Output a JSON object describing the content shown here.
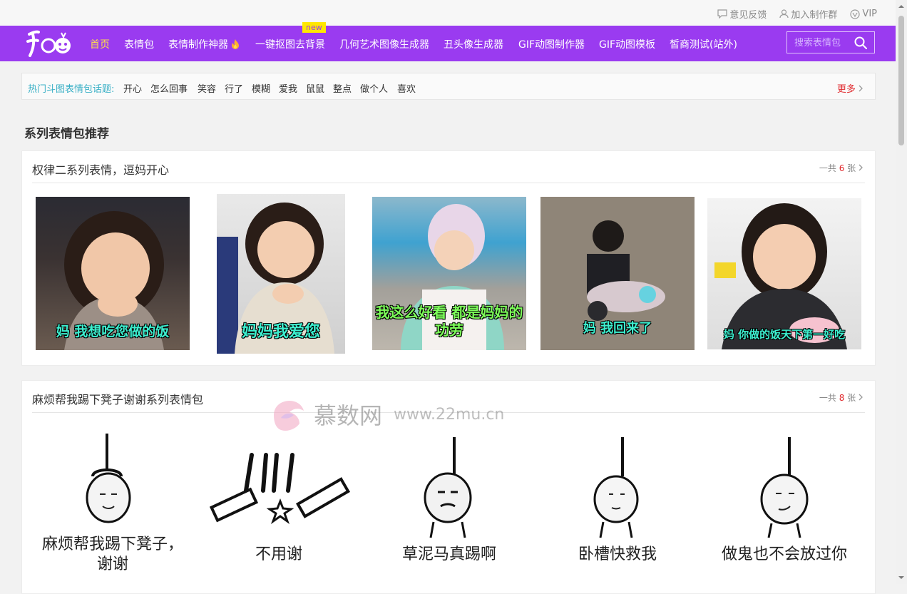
{
  "topbar": {
    "feedback": "意见反馈",
    "join_group": "加入制作群",
    "vip": "VIP"
  },
  "nav": {
    "logo_alt": "斗图啦",
    "items": [
      "首页",
      "表情包",
      "表情制作神器",
      "一键抠图去背景",
      "几何艺术图像生成器",
      "丑头像生成器",
      "GIF动图制作器",
      "GIF动图模板",
      "皙商测试(站外)"
    ],
    "new_badge": "new",
    "search_placeholder": "搜索表情包"
  },
  "hot_topics": {
    "label": "热门斗图表情包话题:",
    "topics": [
      "开心",
      "怎么回事",
      "笑容",
      "行了",
      "模糊",
      "爱我",
      "鼠鼠",
      "整点",
      "做个人",
      "喜欢"
    ],
    "more": "更多"
  },
  "section_title": "系列表情包推荐",
  "series": [
    {
      "title": "权律二系列表情，逗妈开心",
      "count_prefix": "一共",
      "count": "6",
      "count_suffix": "张",
      "images": [
        {
          "caption": "妈 我想吃您做的饭"
        },
        {
          "caption": "妈妈我爱您"
        },
        {
          "caption": "我这么好看 都是妈妈的功劳"
        },
        {
          "caption": "妈 我回来了"
        },
        {
          "caption": "妈 你做的饭天下第一好吃"
        }
      ]
    },
    {
      "title": "麻烦帮我踢下凳子谢谢系列表情包",
      "count_prefix": "一共",
      "count": "8",
      "count_suffix": "张",
      "images": [
        {
          "caption": "麻烦帮我踢下凳子，谢谢"
        },
        {
          "caption": "不用谢"
        },
        {
          "caption": "草泥马真踢啊"
        },
        {
          "caption": "卧槽快救我"
        },
        {
          "caption": "做鬼也不会放过你"
        }
      ]
    }
  ],
  "watermark": {
    "brand": "慕数网",
    "url": "www.22mu.cn"
  },
  "colors": {
    "nav_bg": "#9a3bf0",
    "nav_active": "#ffe04a",
    "accent_red": "#e0292d",
    "topic_label": "#3ab0c6",
    "caption": "#3df0d0"
  }
}
